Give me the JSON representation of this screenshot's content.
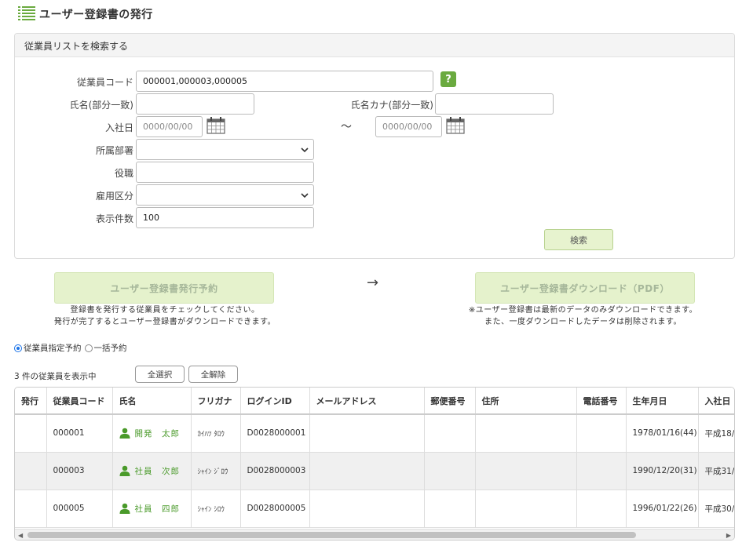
{
  "page": {
    "title": "ユーザー登録書の発行"
  },
  "search": {
    "panel_title": "従業員リストを検索する",
    "employee_code_label": "従業員コード",
    "employee_code_value": "000001,000003,000005",
    "help_label": "?",
    "name_label": "氏名(部分一致)",
    "name_kana_label": "氏名カナ(部分一致)",
    "hire_date_label": "入社日",
    "hire_date_from_placeholder": "0000/00/00",
    "hire_date_to_placeholder": "0000/00/00",
    "range_separator": "～",
    "department_label": "所属部署",
    "position_label": "役職",
    "employment_type_label": "雇用区分",
    "display_count_label": "表示件数",
    "display_count_value": "100",
    "search_button": "検索"
  },
  "actions": {
    "reserve_button": "ユーザー登録書発行予約",
    "reserve_note_1": "登録書を発行する従業員をチェックしてください。",
    "reserve_note_2": "発行が完了するとユーザー登録書がダウンロードできます。",
    "arrow": "→",
    "download_button": "ユーザー登録書ダウンロード（PDF）",
    "download_note_1": "※ユーザー登録書は最新のデータのみダウンロードできます。",
    "download_note_2": "また、一度ダウンロードしたデータは削除されます。"
  },
  "reservation_mode": {
    "options": [
      "従業員指定予約",
      "一括予約"
    ],
    "selected": "従業員指定予約"
  },
  "list": {
    "count_text": "3 件の従業員を表示中",
    "select_all": "全選択",
    "deselect_all": "全解除"
  },
  "table": {
    "columns": [
      "発行",
      "従業員コード",
      "氏名",
      "フリガナ",
      "ログインID",
      "メールアドレス",
      "郵便番号",
      "住所",
      "電話番号",
      "生年月日",
      "入社日"
    ],
    "rows": [
      {
        "code": "000001",
        "name": "開発　太郎",
        "kana": "ｶｲﾊﾂ ﾀﾛｳ",
        "login": "D0028000001",
        "email": "",
        "zip": "",
        "address": "",
        "phone": "",
        "birth": "1978/01/16(44)",
        "hire": "平成18/"
      },
      {
        "code": "000003",
        "name": "社員　次郎",
        "kana": "ｼｬｲﾝ ｼﾞﾛｳ",
        "login": "D0028000003",
        "email": "",
        "zip": "",
        "address": "",
        "phone": "",
        "birth": "1990/12/20(31)",
        "hire": "平成31/"
      },
      {
        "code": "000005",
        "name": "社員　四郎",
        "kana": "ｼｬｲﾝ ｼﾛｳ",
        "login": "D0028000005",
        "email": "",
        "zip": "",
        "address": "",
        "phone": "",
        "birth": "1996/01/22(26)",
        "hire": "平成30/"
      }
    ]
  },
  "scrollbar": {
    "left_arrow": "◀",
    "right_arrow": "▶"
  },
  "colors": {
    "accent_green": "#6aaa3f",
    "name_green": "#4a9a2a",
    "button_bg": "#e5f2cc"
  }
}
